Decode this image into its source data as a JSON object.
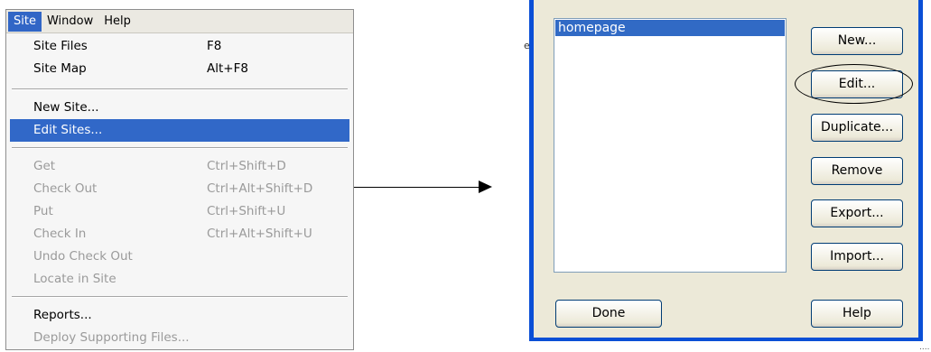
{
  "menubar": {
    "items": [
      "Site",
      "Window",
      "Help"
    ],
    "active": "Site"
  },
  "menu": {
    "items": [
      {
        "label": "Site Files",
        "shortcut": "F8",
        "enabled": true
      },
      {
        "label": "Site Map",
        "shortcut": "Alt+F8",
        "enabled": true
      },
      {
        "label": "New Site...",
        "shortcut": "",
        "enabled": true
      },
      {
        "label": "Edit Sites...",
        "shortcut": "",
        "enabled": true,
        "highlighted": true
      },
      {
        "label": "Get",
        "shortcut": "Ctrl+Shift+D",
        "enabled": false
      },
      {
        "label": "Check Out",
        "shortcut": "Ctrl+Alt+Shift+D",
        "enabled": false
      },
      {
        "label": "Put",
        "shortcut": "Ctrl+Shift+U",
        "enabled": false
      },
      {
        "label": "Check In",
        "shortcut": "Ctrl+Alt+Shift+U",
        "enabled": false
      },
      {
        "label": "Undo Check Out",
        "shortcut": "",
        "enabled": false
      },
      {
        "label": "Locate in Site",
        "shortcut": "",
        "enabled": false
      },
      {
        "label": "Reports...",
        "shortcut": "",
        "enabled": true
      },
      {
        "label": "Deploy Supporting Files...",
        "shortcut": "",
        "enabled": false
      }
    ]
  },
  "dialog": {
    "sites": [
      "homepage"
    ],
    "selected_site": "homepage",
    "buttons": {
      "new": "New...",
      "edit": "Edit...",
      "duplicate": "Duplicate...",
      "remove": "Remove",
      "export": "Export...",
      "import": "Import...",
      "done": "Done",
      "help": "Help"
    }
  },
  "stray": {
    "left_glyph": "e",
    "bottom_dots": "...."
  },
  "colors": {
    "menu_highlight": "#3168c8",
    "dialog_border": "#0a4fd6",
    "dialog_face": "#ece9d8",
    "disabled_text": "#9a9a9a"
  }
}
